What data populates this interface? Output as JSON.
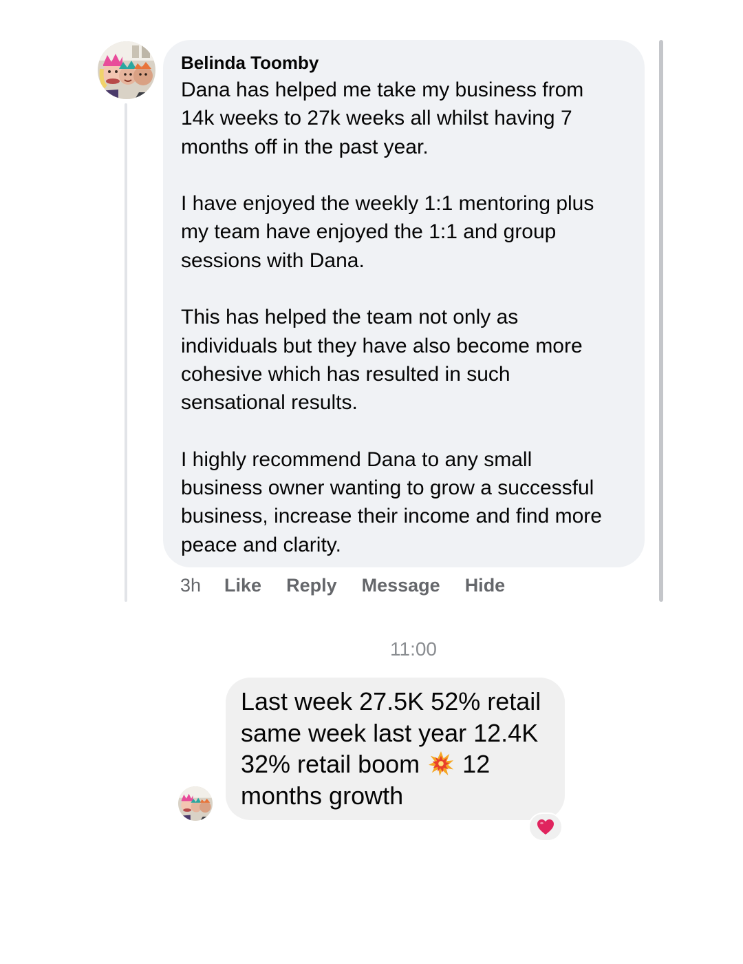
{
  "comment": {
    "author": "Belinda Toomby",
    "paragraphs": [
      [
        "Dana has helped me take my business from",
        "14k weeks to 27k weeks all whilst having 7",
        "months off in the past year."
      ],
      [
        "I have enjoyed the weekly 1:1 mentoring plus",
        "my team have enjoyed the 1:1 and group",
        "sessions with Dana."
      ],
      [
        "This has helped the team not only as",
        "individuals but they have also become more",
        "cohesive which has resulted in such",
        "sensational results."
      ],
      [
        "I highly recommend Dana to any small",
        "business owner wanting to grow a successful",
        "business, increase their income and find more",
        "peace and clarity."
      ]
    ],
    "time": "3h",
    "actions": {
      "like": "Like",
      "reply": "Reply",
      "message": "Message",
      "hide": "Hide"
    }
  },
  "messenger": {
    "timestamp": "11:00",
    "message_lines": [
      "Last week 27.5K 52% retail",
      "same week last year 12.4K",
      "32% retail boom",
      "12",
      "months growth"
    ],
    "inline_emoji": "collision-icon",
    "reaction": "red-heart-icon"
  },
  "colors": {
    "comment_bubble": "#f0f2f5",
    "message_bubble": "#f0f0f0",
    "secondary_text": "#65676b",
    "timestamp_text": "#8a8d91",
    "heart": "#e0245e"
  }
}
